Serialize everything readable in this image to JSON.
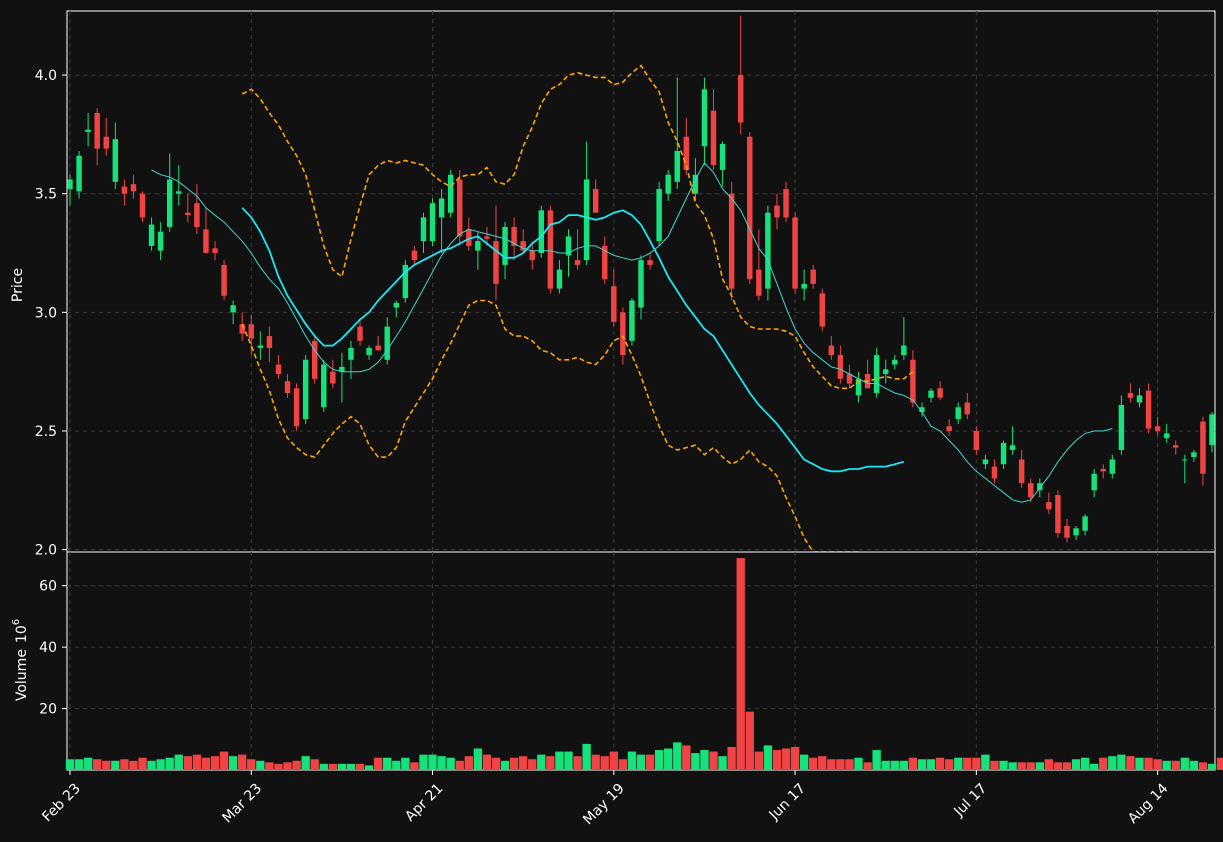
{
  "colors": {
    "background": "#111111",
    "panel_border": "#ffffff",
    "grid": "#3a3a3a",
    "up": "#16e27b",
    "down": "#f04444",
    "ma_fast": "#3fd6d0",
    "ma_slow": "#18e8f4",
    "bands": "#ffa500",
    "text": "#ffffff"
  },
  "chart_data": {
    "type": "candlestick",
    "title": "",
    "price_panel": {
      "ylabel": "Price",
      "ylim": [
        1.99,
        4.27
      ],
      "yticks": [
        "2.0",
        "2.5",
        "3.0",
        "3.5",
        "4.0"
      ],
      "grid": true
    },
    "volume_panel": {
      "ylabel": "Volume",
      "ylabel_exponent": "10",
      "ylabel_power": "6",
      "ylim": [
        0,
        70
      ],
      "yticks": [
        "20",
        "40",
        "60"
      ],
      "grid": true
    },
    "x_tick_labels": [
      {
        "label": "Feb 23",
        "index": 0
      },
      {
        "label": "Mar 23",
        "index": 20
      },
      {
        "label": "Apr 21",
        "index": 40
      },
      {
        "label": "May 19",
        "index": 60
      },
      {
        "label": "Jun 17",
        "index": 80
      },
      {
        "label": "Jul 17",
        "index": 100
      },
      {
        "label": "Aug 14",
        "index": 120
      }
    ],
    "ohlc": [
      [
        3.52,
        3.58,
        3.45,
        3.56
      ],
      [
        3.51,
        3.68,
        3.48,
        3.66
      ],
      [
        3.76,
        3.84,
        3.7,
        3.77
      ],
      [
        3.84,
        3.86,
        3.62,
        3.69
      ],
      [
        3.74,
        3.82,
        3.66,
        3.69
      ],
      [
        3.55,
        3.8,
        3.52,
        3.73
      ],
      [
        3.53,
        3.56,
        3.45,
        3.5
      ],
      [
        3.54,
        3.58,
        3.48,
        3.51
      ],
      [
        3.5,
        3.51,
        3.38,
        3.4
      ],
      [
        3.28,
        3.4,
        3.26,
        3.37
      ],
      [
        3.26,
        3.38,
        3.22,
        3.34
      ],
      [
        3.36,
        3.67,
        3.34,
        3.56
      ],
      [
        3.5,
        3.62,
        3.45,
        3.51
      ],
      [
        3.42,
        3.5,
        3.38,
        3.41
      ],
      [
        3.46,
        3.54,
        3.33,
        3.36
      ],
      [
        3.35,
        3.44,
        3.25,
        3.25
      ],
      [
        3.27,
        3.3,
        3.22,
        3.25
      ],
      [
        3.2,
        3.22,
        3.05,
        3.07
      ],
      [
        3.0,
        3.05,
        2.95,
        3.03
      ],
      [
        2.95,
        3.0,
        2.88,
        2.91
      ],
      [
        2.95,
        2.99,
        2.82,
        2.89
      ],
      [
        2.85,
        2.92,
        2.8,
        2.86
      ],
      [
        2.9,
        2.94,
        2.79,
        2.85
      ],
      [
        2.78,
        2.82,
        2.72,
        2.74
      ],
      [
        2.71,
        2.74,
        2.64,
        2.66
      ],
      [
        2.68,
        2.7,
        2.5,
        2.52
      ],
      [
        2.55,
        2.82,
        2.53,
        2.8
      ],
      [
        2.88,
        2.9,
        2.7,
        2.72
      ],
      [
        2.6,
        2.8,
        2.58,
        2.78
      ],
      [
        2.75,
        2.8,
        2.68,
        2.7
      ],
      [
        2.75,
        2.83,
        2.62,
        2.77
      ],
      [
        2.8,
        2.88,
        2.72,
        2.85
      ],
      [
        2.94,
        2.97,
        2.86,
        2.88
      ],
      [
        2.82,
        2.86,
        2.8,
        2.85
      ],
      [
        2.86,
        2.9,
        2.84,
        2.84
      ],
      [
        2.8,
        2.98,
        2.78,
        2.94
      ],
      [
        3.02,
        3.05,
        2.98,
        3.04
      ],
      [
        3.06,
        3.22,
        3.04,
        3.2
      ],
      [
        3.26,
        3.28,
        3.2,
        3.22
      ],
      [
        3.3,
        3.42,
        3.25,
        3.4
      ],
      [
        3.3,
        3.48,
        3.28,
        3.46
      ],
      [
        3.4,
        3.52,
        3.25,
        3.48
      ],
      [
        3.42,
        3.6,
        3.4,
        3.58
      ],
      [
        3.56,
        3.6,
        3.28,
        3.32
      ],
      [
        3.35,
        3.4,
        3.26,
        3.28
      ],
      [
        3.26,
        3.34,
        3.18,
        3.3
      ],
      [
        3.32,
        3.36,
        3.28,
        3.31
      ],
      [
        3.3,
        3.45,
        3.05,
        3.12
      ],
      [
        3.2,
        3.38,
        3.14,
        3.36
      ],
      [
        3.36,
        3.4,
        3.22,
        3.28
      ],
      [
        3.3,
        3.35,
        3.25,
        3.26
      ],
      [
        3.26,
        3.3,
        3.18,
        3.22
      ],
      [
        3.25,
        3.45,
        3.23,
        3.43
      ],
      [
        3.43,
        3.45,
        3.08,
        3.1
      ],
      [
        3.1,
        3.22,
        3.08,
        3.18
      ],
      [
        3.24,
        3.35,
        3.15,
        3.32
      ],
      [
        3.22,
        3.35,
        3.18,
        3.2
      ],
      [
        3.22,
        3.72,
        3.2,
        3.56
      ],
      [
        3.52,
        3.56,
        3.42,
        3.42
      ],
      [
        3.28,
        3.32,
        3.12,
        3.14
      ],
      [
        3.11,
        3.18,
        2.94,
        2.96
      ],
      [
        3.0,
        3.02,
        2.78,
        2.82
      ],
      [
        2.88,
        3.06,
        2.86,
        3.05
      ],
      [
        3.02,
        3.24,
        2.97,
        3.22
      ],
      [
        3.22,
        3.25,
        3.18,
        3.2
      ],
      [
        3.3,
        3.55,
        3.28,
        3.52
      ],
      [
        3.5,
        3.6,
        3.47,
        3.58
      ],
      [
        3.55,
        3.99,
        3.52,
        3.68
      ],
      [
        3.74,
        3.82,
        3.58,
        3.6
      ],
      [
        3.5,
        3.65,
        3.47,
        3.58
      ],
      [
        3.7,
        3.99,
        3.62,
        3.94
      ],
      [
        3.85,
        3.94,
        3.6,
        3.62
      ],
      [
        3.6,
        3.72,
        3.53,
        3.71
      ],
      [
        3.5,
        3.55,
        3.05,
        3.1
      ],
      [
        4.0,
        4.25,
        3.75,
        3.8
      ],
      [
        3.74,
        3.76,
        3.12,
        3.14
      ],
      [
        3.18,
        3.35,
        3.05,
        3.07
      ],
      [
        3.1,
        3.45,
        3.05,
        3.42
      ],
      [
        3.45,
        3.5,
        3.35,
        3.4
      ],
      [
        3.52,
        3.55,
        3.38,
        3.4
      ],
      [
        3.4,
        3.42,
        3.08,
        3.1
      ],
      [
        3.1,
        3.18,
        3.05,
        3.12
      ],
      [
        3.18,
        3.2,
        3.1,
        3.12
      ],
      [
        3.08,
        3.1,
        2.92,
        2.94
      ],
      [
        2.86,
        2.9,
        2.8,
        2.82
      ],
      [
        2.82,
        2.86,
        2.7,
        2.72
      ],
      [
        2.74,
        2.78,
        2.68,
        2.7
      ],
      [
        2.65,
        2.75,
        2.62,
        2.72
      ],
      [
        2.74,
        2.8,
        2.7,
        2.68
      ],
      [
        2.66,
        2.85,
        2.64,
        2.82
      ],
      [
        2.74,
        2.8,
        2.7,
        2.76
      ],
      [
        2.78,
        2.82,
        2.76,
        2.8
      ],
      [
        2.82,
        2.98,
        2.8,
        2.86
      ],
      [
        2.8,
        2.84,
        2.6,
        2.62
      ],
      [
        2.58,
        2.62,
        2.56,
        2.6
      ],
      [
        2.64,
        2.68,
        2.62,
        2.67
      ],
      [
        2.68,
        2.71,
        2.63,
        2.64
      ],
      [
        2.52,
        2.55,
        2.48,
        2.5
      ],
      [
        2.55,
        2.62,
        2.53,
        2.6
      ],
      [
        2.62,
        2.66,
        2.55,
        2.57
      ],
      [
        2.5,
        2.52,
        2.4,
        2.42
      ],
      [
        2.36,
        2.4,
        2.34,
        2.38
      ],
      [
        2.35,
        2.38,
        2.28,
        2.3
      ],
      [
        2.36,
        2.46,
        2.34,
        2.45
      ],
      [
        2.42,
        2.52,
        2.4,
        2.44
      ],
      [
        2.38,
        2.42,
        2.26,
        2.28
      ],
      [
        2.28,
        2.3,
        2.2,
        2.22
      ],
      [
        2.25,
        2.3,
        2.22,
        2.28
      ],
      [
        2.2,
        2.24,
        2.15,
        2.17
      ],
      [
        2.23,
        2.25,
        2.05,
        2.07
      ],
      [
        2.1,
        2.13,
        2.03,
        2.05
      ],
      [
        2.06,
        2.1,
        2.04,
        2.09
      ],
      [
        2.08,
        2.15,
        2.06,
        2.14
      ],
      [
        2.25,
        2.34,
        2.22,
        2.32
      ],
      [
        2.34,
        2.36,
        2.3,
        2.33
      ],
      [
        2.32,
        2.4,
        2.3,
        2.38
      ],
      [
        2.42,
        2.65,
        2.4,
        2.61
      ],
      [
        2.66,
        2.7,
        2.62,
        2.64
      ],
      [
        2.62,
        2.68,
        2.6,
        2.65
      ],
      [
        2.67,
        2.7,
        2.49,
        2.51
      ],
      [
        2.52,
        2.56,
        2.48,
        2.5
      ],
      [
        2.47,
        2.53,
        2.45,
        2.49
      ],
      [
        2.44,
        2.46,
        2.4,
        2.43
      ],
      [
        2.38,
        2.4,
        2.28,
        2.38
      ],
      [
        2.39,
        2.42,
        2.37,
        2.41
      ],
      [
        2.54,
        2.56,
        2.27,
        2.32
      ],
      [
        2.44,
        2.58,
        2.41,
        2.57
      ]
    ],
    "volume": [
      3.5,
      3.5,
      4,
      3.5,
      3,
      3,
      3.5,
      3,
      4,
      3,
      3.5,
      4,
      5,
      4.5,
      5,
      4,
      4.5,
      6,
      4.5,
      5,
      3.5,
      3,
      2.5,
      2,
      2.5,
      3,
      4.5,
      3.5,
      2,
      2,
      2,
      2,
      2,
      1.5,
      4,
      4,
      3,
      4,
      2.5,
      5,
      5,
      4.5,
      4,
      3,
      4.5,
      7,
      5,
      4,
      3,
      4,
      4.5,
      3.5,
      5,
      4.5,
      6,
      6,
      4.5,
      8.5,
      5,
      4.5,
      6,
      3.5,
      6,
      5,
      5,
      6.5,
      7,
      9,
      8,
      5.5,
      6.5,
      6,
      4.5,
      7.5,
      69,
      19,
      6,
      8,
      6.5,
      7,
      7.5,
      5,
      4,
      4.5,
      3.5,
      3.5,
      3.5,
      4,
      2.5,
      6.5,
      3,
      3,
      3,
      4,
      3.5,
      3.5,
      4,
      3.5,
      4,
      4,
      4,
      5,
      3,
      3,
      2.5,
      2.5,
      2.5,
      2.5,
      3.5,
      2.5,
      2.5,
      3.5,
      4,
      2,
      4,
      4.5,
      5,
      4.5,
      4,
      4,
      3.5,
      3,
      3,
      4,
      3,
      2.5,
      2,
      4,
      3.5,
      3,
      4
    ],
    "ma_fast": {
      "start_index": 9,
      "values": [
        3.6,
        3.58,
        3.57,
        3.55,
        3.52,
        3.49,
        3.44,
        3.41,
        3.38,
        3.34,
        3.3,
        3.25,
        3.19,
        3.14,
        3.1,
        3.04,
        2.97,
        2.9,
        2.84,
        2.79,
        2.76,
        2.75,
        2.75,
        2.75,
        2.76,
        2.79,
        2.84,
        2.9,
        2.96,
        3.03,
        3.1,
        3.17,
        3.24,
        3.29,
        3.33,
        3.35,
        3.34,
        3.33,
        3.32,
        3.31,
        3.29,
        3.27,
        3.26,
        3.26,
        3.26,
        3.25,
        3.25,
        3.27,
        3.28,
        3.28,
        3.26,
        3.24,
        3.23,
        3.22,
        3.23,
        3.25,
        3.28,
        3.32,
        3.4,
        3.48,
        3.56,
        3.63,
        3.59,
        3.52,
        3.48,
        3.43,
        3.35,
        3.27,
        3.22,
        3.12,
        3.02,
        2.93,
        2.87,
        2.83,
        2.8,
        2.77,
        2.76,
        2.74,
        2.72,
        2.7,
        2.7,
        2.68,
        2.66,
        2.65,
        2.63,
        2.58,
        2.52,
        2.5,
        2.46,
        2.42,
        2.37,
        2.33,
        2.3,
        2.27,
        2.24,
        2.21,
        2.2,
        2.21,
        2.26,
        2.31,
        2.37,
        2.42,
        2.46,
        2.49,
        2.5,
        2.5,
        2.51
      ]
    },
    "ma_slow": {
      "start_index": 19,
      "values": [
        3.44,
        3.4,
        3.34,
        3.26,
        3.15,
        3.07,
        3.01,
        2.95,
        2.9,
        2.86,
        2.86,
        2.89,
        2.93,
        2.97,
        3.0,
        3.05,
        3.09,
        3.13,
        3.17,
        3.2,
        3.22,
        3.24,
        3.26,
        3.27,
        3.29,
        3.31,
        3.32,
        3.29,
        3.26,
        3.23,
        3.23,
        3.25,
        3.29,
        3.32,
        3.37,
        3.38,
        3.41,
        3.41,
        3.4,
        3.39,
        3.4,
        3.42,
        3.43,
        3.41,
        3.37,
        3.3,
        3.23,
        3.15,
        3.09,
        3.03,
        2.98,
        2.93,
        2.9,
        2.84,
        2.78,
        2.72,
        2.66,
        2.61,
        2.57,
        2.53,
        2.48,
        2.43,
        2.38,
        2.36,
        2.34,
        2.33,
        2.33,
        2.34,
        2.34,
        2.35,
        2.35,
        2.35,
        2.36,
        2.37
      ]
    },
    "bands_upper": {
      "start_index": 19,
      "values": [
        3.92,
        3.94,
        3.9,
        3.84,
        3.79,
        3.72,
        3.66,
        3.58,
        3.43,
        3.28,
        3.18,
        3.15,
        3.31,
        3.45,
        3.58,
        3.62,
        3.64,
        3.63,
        3.64,
        3.63,
        3.62,
        3.58,
        3.55,
        3.53,
        3.57,
        3.58,
        3.58,
        3.61,
        3.55,
        3.54,
        3.58,
        3.7,
        3.78,
        3.88,
        3.94,
        3.96,
        4.0,
        4.01,
        4.0,
        3.99,
        3.99,
        3.96,
        3.97,
        4.01,
        4.04,
        3.98,
        3.93,
        3.8,
        3.72,
        3.62,
        3.46,
        3.41,
        3.31,
        3.14,
        3.07,
        2.98,
        2.94,
        2.93,
        2.93,
        2.93,
        2.92,
        2.9,
        2.83,
        2.77,
        2.73,
        2.69,
        2.68,
        2.68,
        2.71,
        2.71,
        2.72,
        2.73,
        2.72,
        2.72,
        2.75
      ]
    },
    "bands_lower": {
      "start_index": 19,
      "values": [
        2.95,
        2.86,
        2.76,
        2.67,
        2.55,
        2.47,
        2.43,
        2.4,
        2.39,
        2.44,
        2.49,
        2.53,
        2.56,
        2.53,
        2.44,
        2.39,
        2.39,
        2.43,
        2.54,
        2.6,
        2.66,
        2.72,
        2.8,
        2.87,
        2.95,
        3.03,
        3.05,
        3.05,
        3.03,
        2.93,
        2.9,
        2.9,
        2.88,
        2.84,
        2.83,
        2.8,
        2.8,
        2.81,
        2.79,
        2.78,
        2.82,
        2.88,
        2.9,
        2.82,
        2.73,
        2.62,
        2.52,
        2.44,
        2.42,
        2.43,
        2.44,
        2.4,
        2.43,
        2.39,
        2.36,
        2.38,
        2.42,
        2.37,
        2.35,
        2.31,
        2.22,
        2.14,
        2.05,
        1.98,
        1.96,
        1.97,
        1.97,
        1.98,
        1.99
      ]
    }
  }
}
